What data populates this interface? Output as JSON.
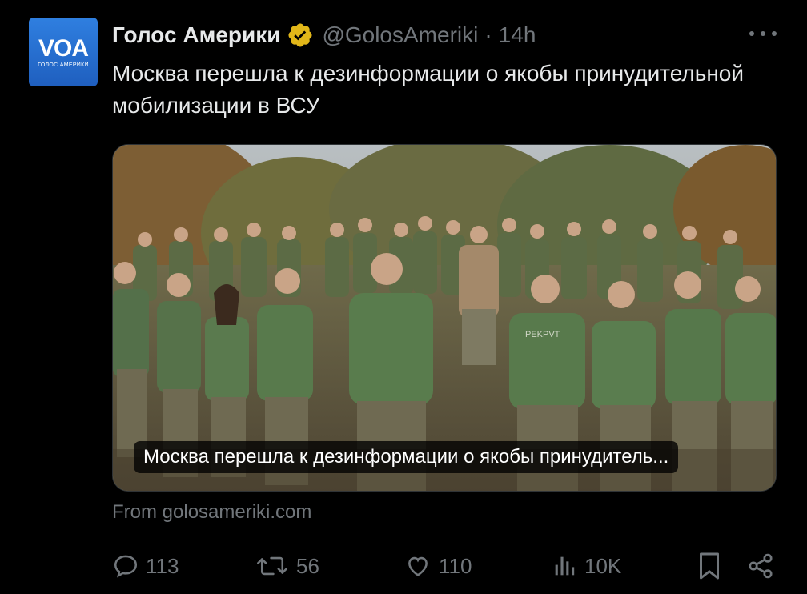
{
  "avatar": {
    "logo_text": "VOA",
    "logo_subtext": "ГОЛОС АМЕРИКИ",
    "color": "#2a73d8"
  },
  "author": {
    "display_name": "Голос Америки",
    "verified_badge_color": "#e2b719",
    "handle": "@GolosAmeriki",
    "separator": "·",
    "time": "14h"
  },
  "tweet": {
    "text": "Москва перешла к дезинформации о якобы принудительной мобилизации в ВСУ"
  },
  "card": {
    "caption": "Москва перешла к дезинформации о якобы принудитель...",
    "source": "From golosameriki.com",
    "shirt_print": "PEKPVT"
  },
  "actions": {
    "reply": {
      "icon": "reply-icon",
      "count": "113"
    },
    "retweet": {
      "icon": "retweet-icon",
      "count": "56"
    },
    "like": {
      "icon": "heart-icon",
      "count": "110"
    },
    "views": {
      "icon": "views-icon",
      "count": "10K"
    },
    "bookmark": {
      "icon": "bookmark-icon"
    },
    "share": {
      "icon": "share-icon"
    }
  },
  "colors": {
    "background": "#000000",
    "text": "#e7e9ea",
    "muted": "#71767b"
  }
}
